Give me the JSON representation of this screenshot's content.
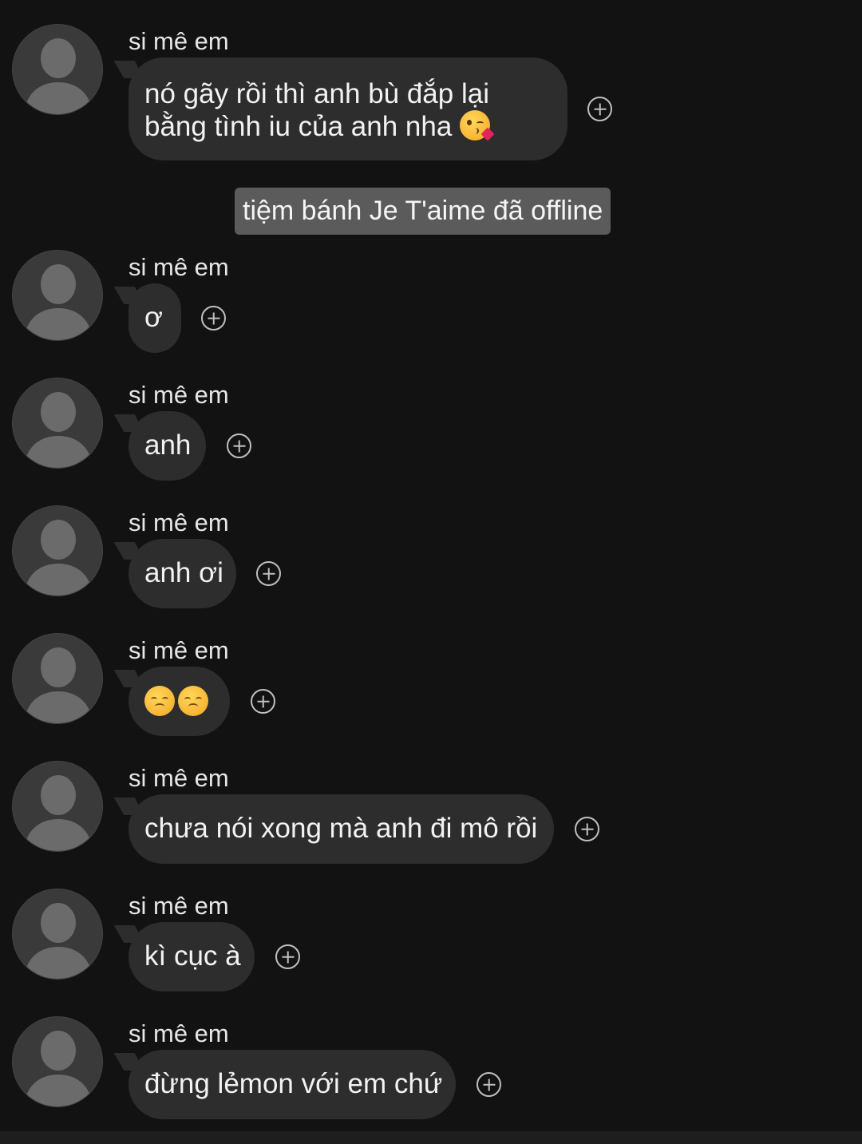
{
  "messages": [
    {
      "sender": "si mê em",
      "lines": [
        "nó gãy rồi thì anh bù đắp lại",
        "bằng tình iu của anh nha"
      ],
      "emoji": "face-blowing-kiss-emoji"
    },
    {
      "sender": "si mê em",
      "text": "ơ"
    },
    {
      "sender": "si mê em",
      "text": "anh"
    },
    {
      "sender": "si mê em",
      "text": "anh ơi"
    },
    {
      "sender": "si mê em",
      "text": "",
      "emoji": "disappointed-face-emoji x2"
    },
    {
      "sender": "si mê em",
      "text": "chưa nói xong mà anh đi mô rồi"
    },
    {
      "sender": "si mê em",
      "text": "kì cục à"
    },
    {
      "sender": "si mê em",
      "text": "đừng lẻmon với em chứ"
    }
  ],
  "system_note": "tiệm bánh Je T'aime đã offline",
  "colors": {
    "background": "#121212",
    "bubble": "#2d2d2d",
    "system_note_bg": "#5b5b5b",
    "text": "#f2f2f2"
  },
  "icons": {
    "avatar": "default-avatar-icon",
    "add_reaction": "plus-circle-icon"
  }
}
